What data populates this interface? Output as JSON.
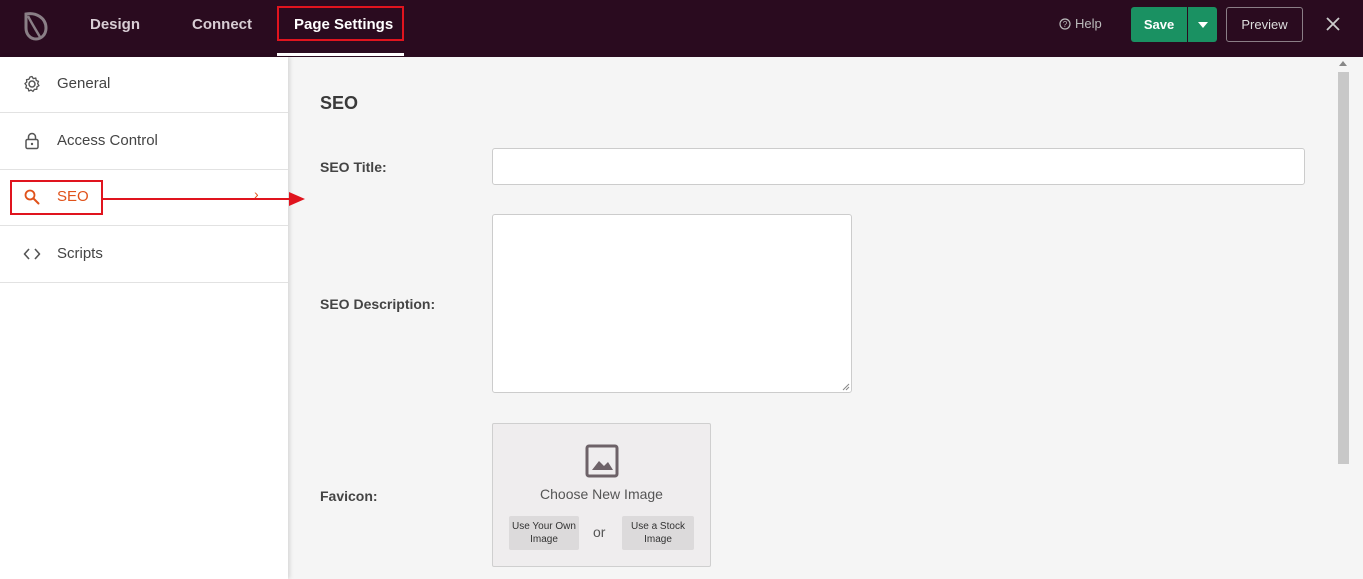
{
  "topbar": {
    "tabs": [
      {
        "label": "Design"
      },
      {
        "label": "Connect"
      },
      {
        "label": "Page Settings",
        "active": true
      }
    ],
    "help_label": "Help",
    "save_label": "Save",
    "preview_label": "Preview"
  },
  "sidebar": {
    "items": [
      {
        "label": "General",
        "icon": "gear-icon"
      },
      {
        "label": "Access Control",
        "icon": "lock-icon"
      },
      {
        "label": "SEO",
        "icon": "search-icon",
        "active": true,
        "chevron": "›"
      },
      {
        "label": "Scripts",
        "icon": "code-icon"
      }
    ]
  },
  "main": {
    "section_title": "SEO",
    "seo_title_label": "SEO Title:",
    "seo_title_value": "",
    "seo_description_label": "SEO Description:",
    "seo_description_value": "",
    "favicon_label": "Favicon:",
    "favicon": {
      "choose_label": "Choose New Image",
      "own_image_label": "Use Your Own Image",
      "or_label": "or",
      "stock_image_label": "Use a Stock Image"
    }
  },
  "colors": {
    "topbar_bg": "#2a0b1f",
    "save_green": "#1a9162",
    "active_orange": "#e0521a",
    "highlight_red": "#e0141e"
  }
}
